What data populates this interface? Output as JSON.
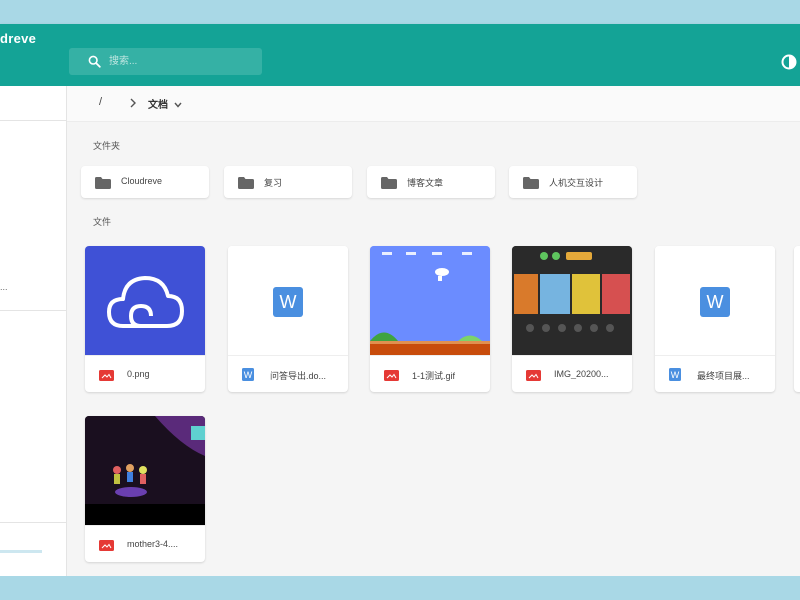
{
  "app": {
    "title": "dreve"
  },
  "search": {
    "placeholder": "搜索..."
  },
  "breadcrumb": {
    "root": "/",
    "current": "文档"
  },
  "sections": {
    "folders": "文件夹",
    "files": "文件"
  },
  "folders": [
    {
      "name": "Cloudreve"
    },
    {
      "name": "复习"
    },
    {
      "name": "博客文章"
    },
    {
      "name": "人机交互设计"
    }
  ],
  "files": [
    {
      "name": "0.png",
      "type": "image",
      "thumb": "cloud-logo"
    },
    {
      "name": "问答导出.do...",
      "type": "word",
      "thumb": "word"
    },
    {
      "name": "1-1测试.gif",
      "type": "image",
      "thumb": "game-level"
    },
    {
      "name": "IMG_20200...",
      "type": "image",
      "thumb": "game-menu"
    },
    {
      "name": "最终项目展...",
      "type": "word",
      "thumb": "word"
    },
    {
      "name": "mother3-4....",
      "type": "image",
      "thumb": "game-scene"
    }
  ],
  "sidebar": {
    "marker": "..."
  },
  "colors": {
    "appbar": "#14a396",
    "folder_icon": "#666666",
    "image_icon": "#e53935",
    "word_icon": "#4a8fe0",
    "thumb_blue": "#3f51d6"
  }
}
